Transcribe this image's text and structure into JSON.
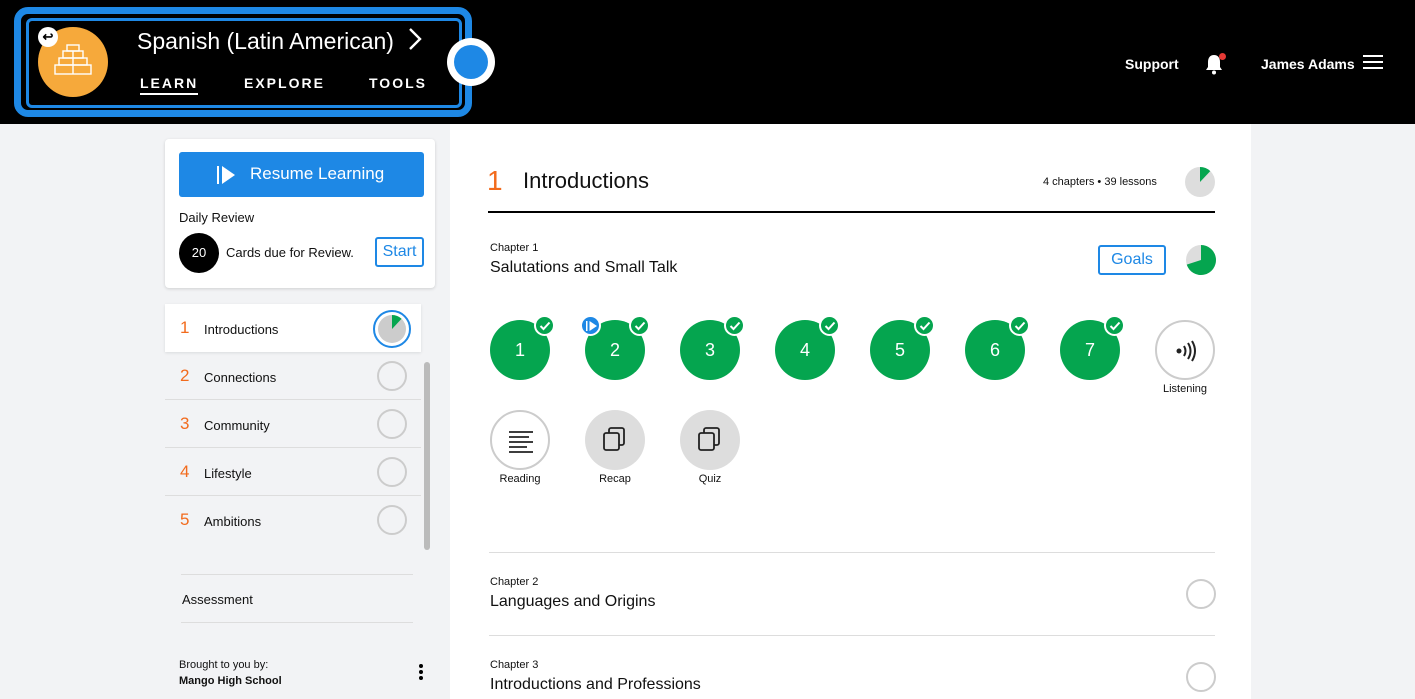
{
  "header": {
    "course_title": "Spanish (Latin American)",
    "tabs": [
      {
        "label": "LEARN",
        "active": true
      },
      {
        "label": "EXPLORE",
        "active": false
      },
      {
        "label": "TOOLS",
        "active": false
      }
    ],
    "support": "Support",
    "user": "James Adams",
    "notification_dot_color": "#e53935"
  },
  "sidebar": {
    "resume_label": "Resume Learning",
    "daily_review_label": "Daily Review",
    "cards_due_count": "20",
    "cards_due_text": "Cards due for Review.",
    "start_label": "Start",
    "units": [
      {
        "num": "1",
        "name": "Introductions",
        "progress": 0.12
      },
      {
        "num": "2",
        "name": "Connections",
        "progress": 0
      },
      {
        "num": "3",
        "name": "Community",
        "progress": 0
      },
      {
        "num": "4",
        "name": "Lifestyle",
        "progress": 0
      },
      {
        "num": "5",
        "name": "Ambitions",
        "progress": 0
      }
    ],
    "assessment": "Assessment",
    "brought_by": "Brought to you by:",
    "school": "Mango High School"
  },
  "main": {
    "unit_number": "1",
    "unit_title": "Introductions",
    "unit_meta": "4 chapters • 39 lessons",
    "unit_progress": 0.12,
    "chapter1": {
      "label": "Chapter 1",
      "title": "Salutations and Small Talk",
      "goals_label": "Goals",
      "progress": 0.7,
      "lessons": [
        "1",
        "2",
        "3",
        "4",
        "5",
        "6",
        "7"
      ],
      "activities": {
        "listening": "Listening",
        "reading": "Reading",
        "recap": "Recap",
        "quiz": "Quiz"
      }
    },
    "chapter2": {
      "label": "Chapter 2",
      "title": "Languages and Origins"
    },
    "chapter3": {
      "label": "Chapter 3",
      "title": "Introductions and Professions"
    }
  },
  "colors": {
    "accent_blue": "#1e88e5",
    "success_green": "#05a54f",
    "unit_orange": "#f26b1d",
    "course_icon_orange": "#f6a93b"
  }
}
